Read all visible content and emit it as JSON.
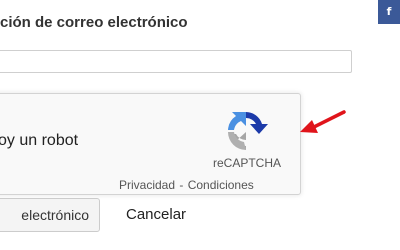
{
  "form": {
    "email_label": "ción de correo electrónico",
    "email_value": "",
    "send_button_label": "electrónico",
    "cancel_label": "Cancelar"
  },
  "recaptcha": {
    "checkbox_label": "oy un robot",
    "brand": "reCAPTCHA",
    "privacy_link": "Privacidad",
    "separator": "-",
    "terms_link": "Condiciones",
    "logo_icon": "recaptcha-logo-icon"
  },
  "annotation": {
    "arrow_icon": "red-arrow-icon",
    "arrow_color": "#e0141b"
  },
  "social": {
    "facebook_label": "f",
    "facebook_color": "#3b5998"
  }
}
